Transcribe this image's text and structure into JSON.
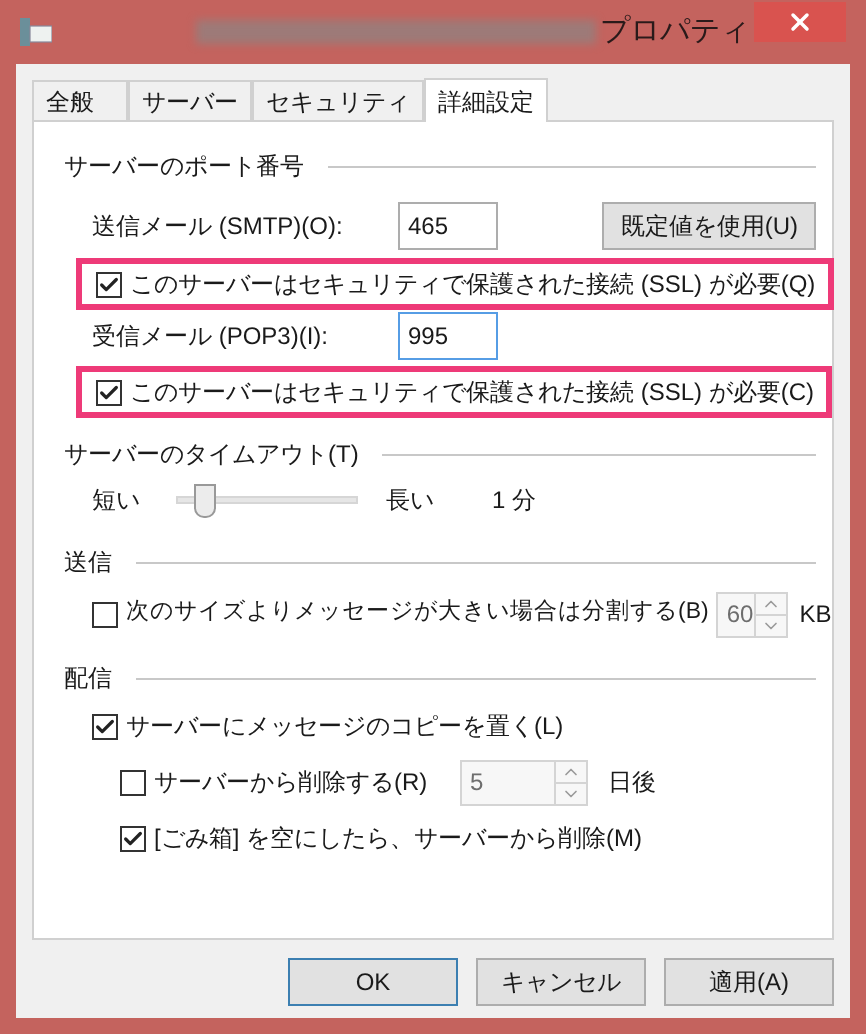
{
  "window": {
    "title": "プロパティ"
  },
  "tabs": [
    {
      "label": "全般",
      "selected": false
    },
    {
      "label": "サーバー",
      "selected": false
    },
    {
      "label": "セキュリティ",
      "selected": false
    },
    {
      "label": "詳細設定",
      "selected": true
    }
  ],
  "ports": {
    "heading": "サーバーのポート番号",
    "outgoing": {
      "label": "送信メール (SMTP)(O):",
      "value": "465"
    },
    "default_button": "既定値を使用(U)",
    "outgoing_ssl": {
      "label": "このサーバーはセキュリティで保護された接続 (SSL) が必要(Q)",
      "checked": true,
      "highlighted": true
    },
    "incoming": {
      "label": "受信メール (POP3)(I):",
      "value": "995"
    },
    "incoming_ssl": {
      "label": "このサーバーはセキュリティで保護された接続 (SSL) が必要(C)",
      "checked": true,
      "highlighted": true
    }
  },
  "timeout": {
    "heading": "サーバーのタイムアウト(T)",
    "short_label": "短い",
    "long_label": "長い",
    "level": 0.15,
    "reading": "1 分"
  },
  "sending": {
    "heading": "送信",
    "split": {
      "label": "次のサイズよりメッセージが大きい場合は分割する(B)",
      "checked": false
    },
    "size": {
      "value": "60",
      "disabled": true
    },
    "unit": "KB"
  },
  "delivery": {
    "heading": "配信",
    "leave_copy": {
      "label": "サーバーにメッセージのコピーを置く(L)",
      "checked": true
    },
    "remove_after": {
      "label": "サーバーから削除する(R)",
      "checked": false
    },
    "days": {
      "value": "5",
      "disabled": true
    },
    "days_unit": "日後",
    "remove_on_empty": {
      "label": "[ごみ箱] を空にしたら、サーバーから削除(M)",
      "checked": true
    }
  },
  "buttons": [
    {
      "label": "OK",
      "default": true
    },
    {
      "label": "キャンセル",
      "default": false
    },
    {
      "label": "適用(A)",
      "default": false
    }
  ]
}
